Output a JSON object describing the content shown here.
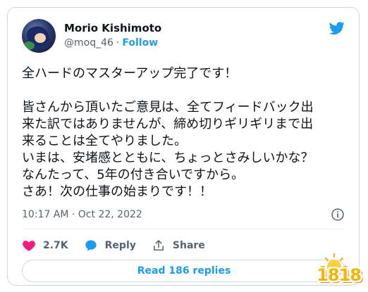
{
  "tweet": {
    "author_name": "Morio Kishimoto",
    "handle": "@moq_46",
    "separator": "·",
    "follow_label": "Follow",
    "text": "全ハードのマスターアップ完了です！\n\n皆さんから頂いたご意見は、全てフィードバック出\n来た訳ではありませんが、締め切りギリギリまで出\n来ることは全てやりました。\nいまは、安堵感とともに、ちょっとさみしいかな？\nなんたって、5年の付き合いですから。\nさあ！次の仕事の始まりです！！",
    "timestamp": "10:17 AM · Oct 22, 2022"
  },
  "actions": {
    "like_count": "2.7K",
    "reply_label": "Reply",
    "share_label": "Share"
  },
  "read_replies_label": "Read 186 replies",
  "watermark": {
    "text": "1818"
  },
  "colors": {
    "twitter_blue": "#1d9bf0",
    "heart_red": "#f91880",
    "secondary_text": "#536471"
  }
}
